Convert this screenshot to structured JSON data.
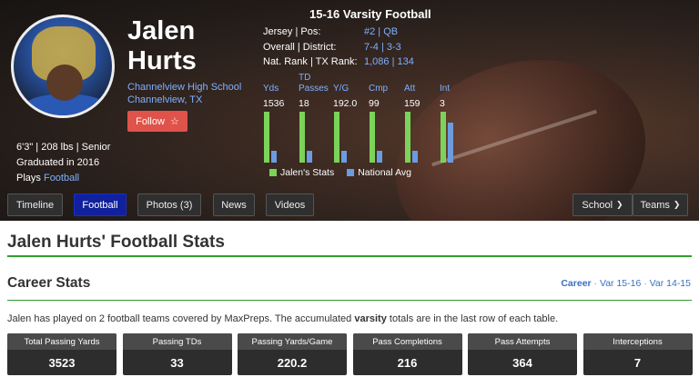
{
  "player": {
    "first_name": "Jalen",
    "last_name": "Hurts",
    "school": "Channelview High School",
    "location": "Channelview, TX",
    "follow_label": "Follow",
    "size": "6'3\" | 208 lbs | Senior",
    "graduated": "Graduated in 2016",
    "plays_prefix": "Plays ",
    "plays_sport": "Football"
  },
  "season": {
    "title": "15-16 Varsity Football",
    "info": [
      {
        "label": "Jersey | Pos:",
        "value": "#2 | QB"
      },
      {
        "label": "Overall | District:",
        "value": "7-4 | 3-3"
      },
      {
        "label": "Nat. Rank | TX Rank:",
        "value": "1,086 | 134"
      }
    ],
    "legend": {
      "player": "Jalen's Stats",
      "national": "National Avg"
    }
  },
  "chart_data": {
    "type": "bar",
    "categories": [
      "Yds",
      "TD Passes",
      "Y/G",
      "Cmp",
      "Att",
      "Int"
    ],
    "value_labels": [
      "1536",
      "18",
      "192.0",
      "99",
      "159",
      "3"
    ],
    "series": [
      {
        "name": "Jalen's Stats",
        "values": [
          1,
          1,
          1,
          1,
          1,
          1
        ]
      },
      {
        "name": "National Avg",
        "values": [
          0.24,
          0.24,
          0.24,
          0.24,
          0.24,
          0.78
        ]
      }
    ],
    "colors": {
      "player": "#7bd35a",
      "national": "#6b9be0"
    }
  },
  "nav": {
    "left": [
      "Timeline",
      "Football",
      "Photos (3)",
      "News",
      "Videos"
    ],
    "active": "Football",
    "right": [
      "School",
      "Teams"
    ]
  },
  "page": {
    "title": "Jalen Hurts' Football Stats",
    "career_title": "Career Stats",
    "career_links": [
      "Career",
      "Var 15-16",
      "Var 14-15"
    ],
    "desc_before": "Jalen has played on 2 football teams covered by MaxPreps. The accumulated ",
    "desc_bold": "varsity",
    "desc_after": " totals are in the last row of each table."
  },
  "summary": [
    {
      "label": "Total Passing Yards",
      "value": "3523"
    },
    {
      "label": "Passing TDs",
      "value": "33"
    },
    {
      "label": "Passing Yards/Game",
      "value": "220.2"
    },
    {
      "label": "Pass Completions",
      "value": "216"
    },
    {
      "label": "Pass Attempts",
      "value": "364"
    },
    {
      "label": "Interceptions",
      "value": "7"
    }
  ]
}
